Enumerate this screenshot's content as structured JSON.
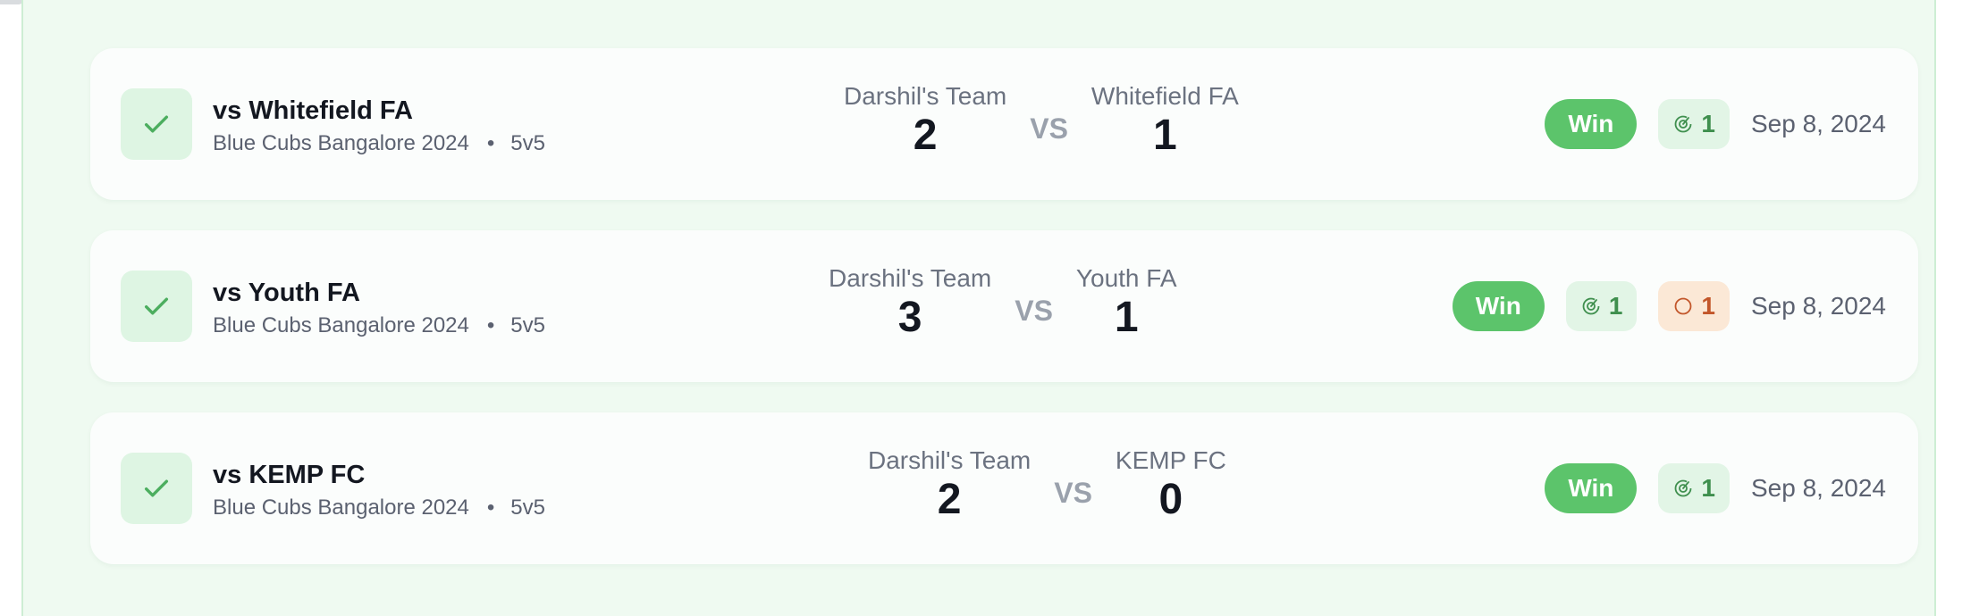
{
  "colors": {
    "win_bg": "#5cc46b",
    "goal_text": "#3f8f4e",
    "assist_text": "#c2562a",
    "check": "#4cae5f"
  },
  "matches": [
    {
      "title": "vs Whitefield FA",
      "competition": "Blue Cubs Bangalore 2024",
      "format": "5v5",
      "home_team": "Darshil's Team",
      "home_score": "2",
      "vs_label": "VS",
      "away_team": "Whitefield FA",
      "away_score": "1",
      "result": "Win",
      "goals": "1",
      "date": "Sep 8, 2024"
    },
    {
      "title": "vs Youth FA",
      "competition": "Blue Cubs Bangalore 2024",
      "format": "5v5",
      "home_team": "Darshil's Team",
      "home_score": "3",
      "vs_label": "VS",
      "away_team": "Youth FA",
      "away_score": "1",
      "result": "Win",
      "goals": "1",
      "assists": "1",
      "date": "Sep 8, 2024"
    },
    {
      "title": "vs KEMP FC",
      "competition": "Blue Cubs Bangalore 2024",
      "format": "5v5",
      "home_team": "Darshil's Team",
      "home_score": "2",
      "vs_label": "VS",
      "away_team": "KEMP FC",
      "away_score": "0",
      "result": "Win",
      "goals": "1",
      "date": "Sep 8, 2024"
    }
  ]
}
